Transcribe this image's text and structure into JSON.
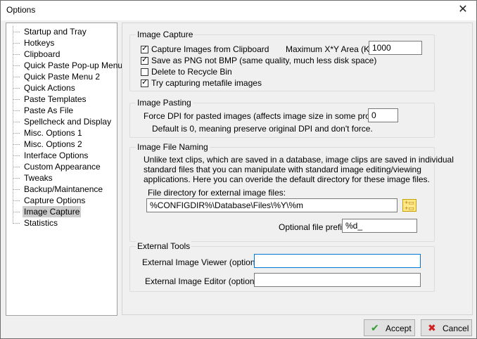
{
  "window": {
    "title": "Options",
    "close_glyph": "✕"
  },
  "tree": {
    "items": [
      {
        "label": "Startup and Tray"
      },
      {
        "label": "Hotkeys"
      },
      {
        "label": "Clipboard"
      },
      {
        "label": "Quick Paste Pop-up Menu"
      },
      {
        "label": "Quick Paste Menu 2"
      },
      {
        "label": "Quick Actions"
      },
      {
        "label": "Paste Templates"
      },
      {
        "label": "Paste As File"
      },
      {
        "label": "Spellcheck and Display"
      },
      {
        "label": "Misc. Options 1"
      },
      {
        "label": "Misc. Options 2"
      },
      {
        "label": "Interface Options"
      },
      {
        "label": "Custom Appearance"
      },
      {
        "label": "Tweaks"
      },
      {
        "label": "Backup/Maintanence"
      },
      {
        "label": "Capture Options"
      },
      {
        "label": "Image Capture"
      },
      {
        "label": "Statistics"
      }
    ],
    "selected": "Image Capture"
  },
  "image_capture": {
    "title": "Image Capture",
    "capture_from_clipboard": {
      "label": "Capture Images from Clipboard",
      "checked": true
    },
    "save_as_png": {
      "label": "Save as PNG not BMP (same quality, much less disk space)",
      "checked": true
    },
    "delete_to_recycle": {
      "label": "Delete to Recycle Bin",
      "checked": false
    },
    "try_metafile": {
      "label": "Try capturing metafile images",
      "checked": true
    },
    "max_area_label": "Maximum X*Y Area (Kb)",
    "max_area_value": "1000"
  },
  "image_pasting": {
    "title": "Image Pasting",
    "force_dpi_label": "Force DPI for pasted images (affects image size in some programs):",
    "force_dpi_value": "0",
    "default_note": "Default is 0, meaning preserve original DPI and don't force."
  },
  "image_file_naming": {
    "title": "Image File Naming",
    "description_line1": "Unlike text clips, which are saved in a database, image clips are saved in individual",
    "description_line2": "standard files that you can manipulate with standard image editing/viewing",
    "description_line3": "applications. Here you can overide the default directory for these image files.",
    "dir_label": "File directory for external image files:",
    "dir_value": "%CONFIGDIR%\\Database\\Files\\%Y\\%m",
    "prefix_label": "Optional file prefix:",
    "prefix_value": "%d_"
  },
  "external_tools": {
    "title": "External Tools",
    "viewer_label": "External Image Viewer (optional):",
    "viewer_value": "",
    "editor_label": "External Image Editor (optional):",
    "editor_value": ""
  },
  "buttons": {
    "accept": "Accept",
    "cancel": "Cancel"
  },
  "colors": {
    "accept_check": "#2e9e2e",
    "cancel_x": "#d02020"
  }
}
